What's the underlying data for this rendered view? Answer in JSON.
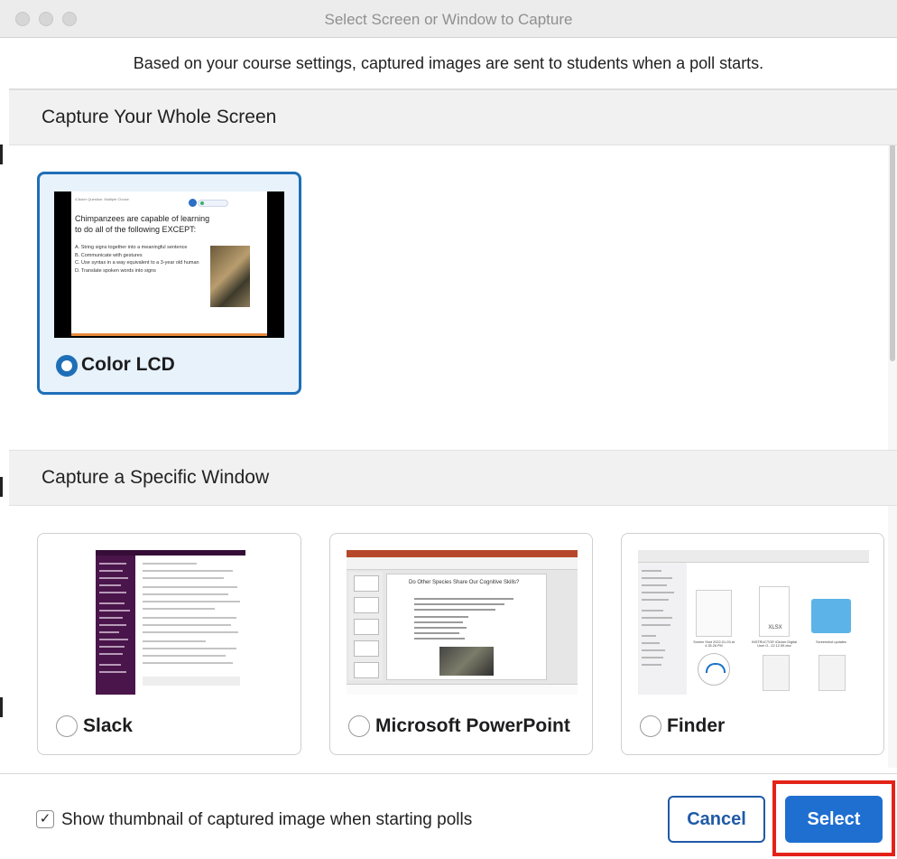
{
  "window": {
    "title": "Select Screen or Window to Capture",
    "notice": "Based on your course settings, captured images are sent to students when a poll starts."
  },
  "sections": {
    "whole_screen": "Capture Your Whole Screen",
    "specific_window": "Capture a Specific Window"
  },
  "screens": [
    {
      "label": "Color LCD",
      "selected": true,
      "thumbnail": {
        "header": "iClicker Question: Multiple Choice",
        "question": "Chimpanzees are capable of learning to do all of the following EXCEPT:",
        "options": [
          "A.  String signs together into a meaningful sentence",
          "B.  Communicate with gestures",
          "C.  Use syntax in a way equivalent to a 3-year old human",
          "D.  Translate spoken words into signs"
        ]
      }
    }
  ],
  "windows": [
    {
      "label": "Slack",
      "selected": false
    },
    {
      "label": "Microsoft PowerPoint",
      "selected": false,
      "thumbnail": {
        "slide_title": "Do Other Species Share Our Cognitive Skills?"
      }
    },
    {
      "label": "Finder",
      "selected": false,
      "thumbnail": {
        "files": [
          "Screen Shot 2022-01-03 at 4.35.26 PM",
          "INSTRUCTOR iClicker Digital User G...22.12.59.xlsx",
          "Screenshot updates"
        ],
        "xlsx_tag": "XLSX"
      }
    }
  ],
  "footer": {
    "checkbox_checked": true,
    "checkbox_mark": "✓",
    "checkbox_label": "Show thumbnail of captured image when starting polls",
    "cancel_label": "Cancel",
    "select_label": "Select"
  },
  "colors": {
    "accent": "#1f6fb8",
    "select_button": "#1f6fd1",
    "highlight": "#e32319"
  }
}
